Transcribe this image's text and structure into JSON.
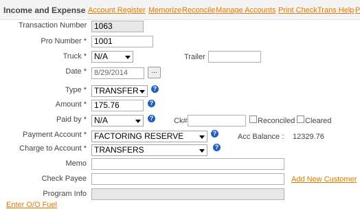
{
  "header": {
    "title": "Income and Expense"
  },
  "nav": [
    {
      "label": "Account Register"
    },
    {
      "label": "Memorize"
    },
    {
      "label": "Reconcile"
    },
    {
      "label": "Manage Accounts"
    },
    {
      "label": "Print Check"
    },
    {
      "label": "Trans Help"
    },
    {
      "label": "P"
    }
  ],
  "form": {
    "transaction_number": {
      "label": "Transaction Number",
      "value": "1063"
    },
    "pro_number": {
      "label": "Pro Number *",
      "value": "1001"
    },
    "truck": {
      "label": "Truck *",
      "value": "N/A"
    },
    "trailer": {
      "label": "Trailer",
      "value": ""
    },
    "date": {
      "label": "Date *",
      "value": "8/29/2014",
      "button": "..."
    },
    "type": {
      "label": "Type *",
      "value": "TRANSFER",
      "help": "?"
    },
    "amount": {
      "label": "Amount *",
      "value": "175.76",
      "help": "?"
    },
    "paid_by": {
      "label": "Paid by *",
      "value": "N/A",
      "help": "?"
    },
    "check_number": {
      "label": "Ck#",
      "value": ""
    },
    "reconciled": {
      "label": "Reconciled",
      "checked": false
    },
    "cleared": {
      "label": "Cleared",
      "checked": false
    },
    "payment_account": {
      "label": "Payment Account *",
      "value": "FACTORING RESERVE",
      "help": "?"
    },
    "acc_balance": {
      "label": "Acc Balance :",
      "value": "12329.76"
    },
    "charge_to_account": {
      "label": "Charge to Account *",
      "value": "TRANSFERS",
      "help": "?"
    },
    "memo": {
      "label": "Memo",
      "value": ""
    },
    "check_payee": {
      "label": "Check Payee",
      "value": ""
    },
    "add_new_customer": {
      "label": "Add New Customer"
    },
    "program_info": {
      "label": "Program Info",
      "value": ""
    }
  },
  "footer": {
    "enter_fuel": "Enter O/O Fuel"
  },
  "colors": {
    "accent_link": "#e07a00",
    "help_icon": "#1f5fbf"
  }
}
